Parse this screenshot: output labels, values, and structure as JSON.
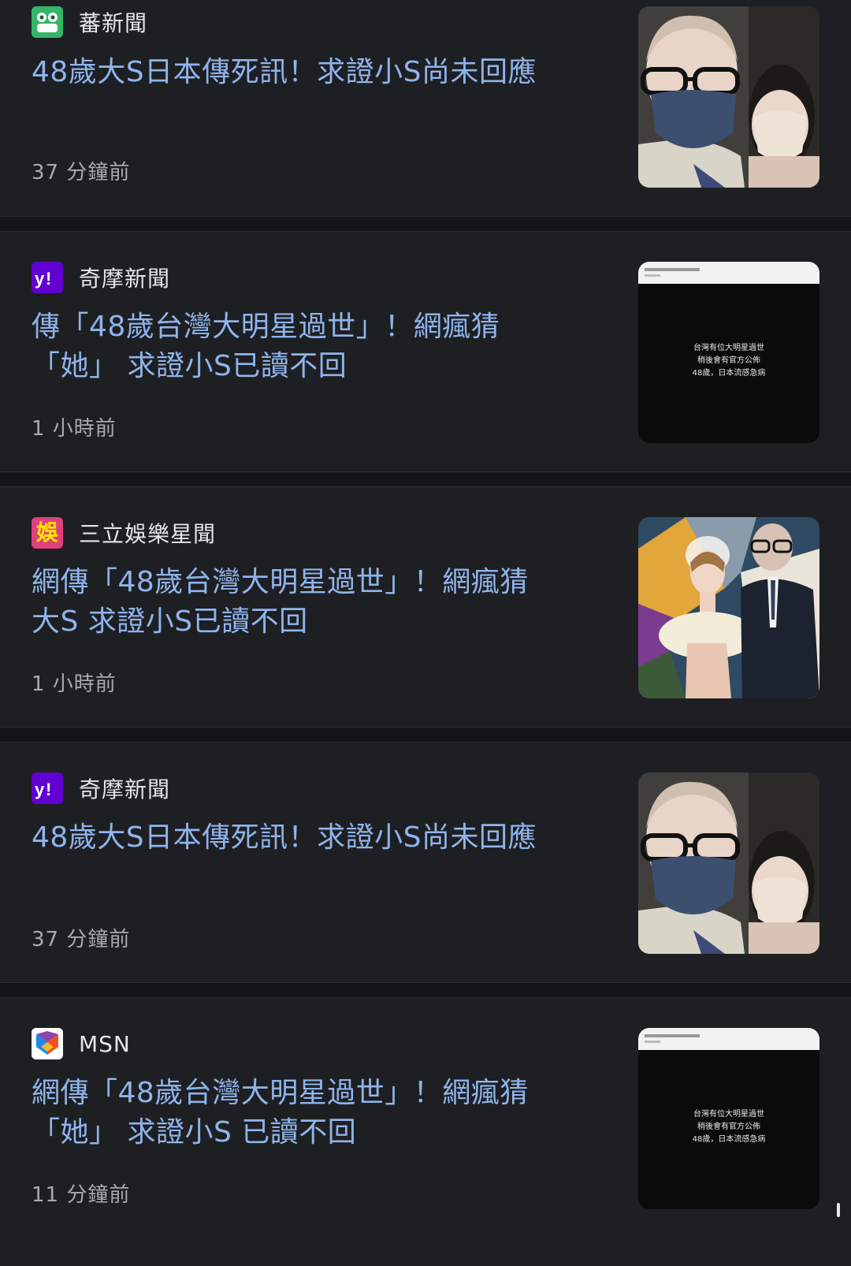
{
  "items": [
    {
      "source": "蕃新聞",
      "logo": "frog-logo-icon",
      "headline": "48歲大S日本傳死訊！求證小S尚未回應",
      "time": "37 分鐘前",
      "thumbnail": "couple-photo-thumbnail"
    },
    {
      "source": "奇摩新聞",
      "logo": "yahoo-logo-icon",
      "headline_lines": [
        "傳「48歲台灣大明星過世」！網瘋猜",
        "「她」 求證小S已讀不回"
      ],
      "time": "1 小時前",
      "thumbnail": "black-post-thumbnail",
      "thumbnail_text": [
        "台灣有位大明星過世",
        "稍後會有官方公佈",
        "48歲，日本流感急病"
      ]
    },
    {
      "source": "三立娛樂星聞",
      "logo": "setn-ent-logo-icon",
      "logo_char": "娛",
      "headline_lines": [
        "網傳「48歲台灣大明星過世」！網瘋猜",
        "大S 求證小S已讀不回"
      ],
      "time": "1 小時前",
      "thumbnail": "wedding-photo-thumbnail"
    },
    {
      "source": "奇摩新聞",
      "logo": "yahoo-logo-icon",
      "headline": "48歲大S日本傳死訊！求證小S尚未回應",
      "time": "37 分鐘前",
      "thumbnail": "couple-photo-thumbnail"
    },
    {
      "source": "MSN",
      "logo": "msn-logo-icon",
      "headline_lines": [
        "網傳「48歲台灣大明星過世」！網瘋猜",
        "「她」 求證小S 已讀不回"
      ],
      "time": "11 分鐘前",
      "thumbnail": "black-post-thumbnail",
      "thumbnail_text": [
        "台灣有位大明星過世",
        "稍後會有官方公佈",
        "48歲，日本流感急病"
      ]
    }
  ],
  "colors": {
    "background": "#1e1f22",
    "headline": "#8fb4ec",
    "meta": "#a9a9ae",
    "frog_green": "#35b56a",
    "yahoo_purple": "#6001d2",
    "setn_pink": "#e23f7d"
  }
}
